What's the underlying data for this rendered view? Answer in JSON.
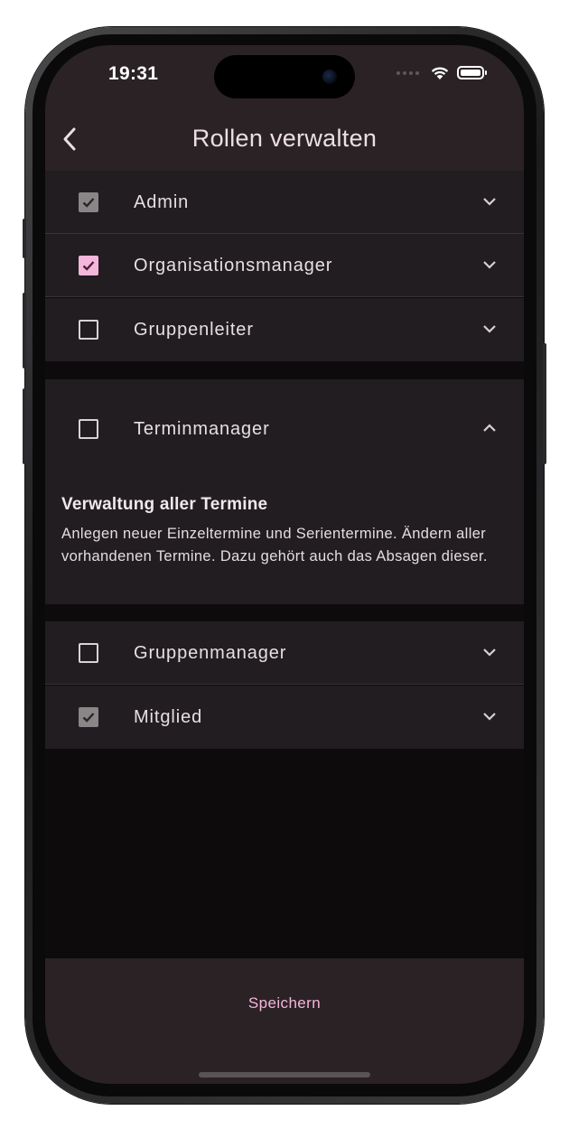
{
  "status_bar": {
    "time": "19:31",
    "icons": [
      "signal-dots-icon",
      "wifi-icon",
      "battery-icon"
    ]
  },
  "header": {
    "title": "Rollen verwalten",
    "back_icon": "chevron-left-icon"
  },
  "roles": [
    {
      "label": "Admin",
      "checked": true,
      "enabled": false,
      "expanded": false
    },
    {
      "label": "Organisationsmanager",
      "checked": true,
      "enabled": true,
      "expanded": false
    },
    {
      "label": "Gruppenleiter",
      "checked": false,
      "enabled": true,
      "expanded": false
    },
    {
      "label": "Terminmanager",
      "checked": false,
      "enabled": true,
      "expanded": true,
      "detail_title": "Verwaltung aller Termine",
      "detail_text": "Anlegen neuer Einzeltermine und Serientermine. Ändern aller vorhandenen Termine. Dazu gehört auch das Absagen dieser."
    },
    {
      "label": "Gruppenmanager",
      "checked": false,
      "enabled": true,
      "expanded": false
    },
    {
      "label": "Mitglied",
      "checked": true,
      "enabled": false,
      "expanded": false
    }
  ],
  "footer": {
    "save_label": "Speichern"
  },
  "colors": {
    "accent": "#f5b6db",
    "surface": "#211d20",
    "header": "#2b2226",
    "background": "#0e0b0d"
  }
}
